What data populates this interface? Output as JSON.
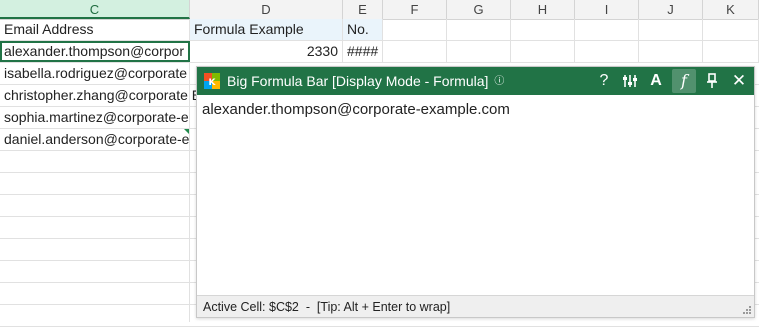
{
  "sheet": {
    "columns": [
      "C",
      "D",
      "E",
      "F",
      "G",
      "H",
      "I",
      "J",
      "K"
    ],
    "rows": [
      {
        "c": "Email Address",
        "d": "Formula Example",
        "e": "No."
      },
      {
        "c": "alexander.thompson@corpor",
        "d": "2330",
        "e": "####"
      },
      {
        "c": "isabella.rodriguez@corporate",
        "d": "",
        "e": ""
      },
      {
        "c": "christopher.zhang@corporate E",
        "d": "",
        "e": ""
      },
      {
        "c": "sophia.martinez@corporate-e",
        "d": "",
        "e": ""
      },
      {
        "c": "daniel.anderson@corporate-e",
        "d": "",
        "e": ""
      }
    ]
  },
  "formula_bar": {
    "title": "Big Formula Bar [Display Mode - Formula]",
    "info_glyph": "ⓘ",
    "content": "alexander.thompson@corporate-example.com",
    "status": "Active Cell: $C$2  -  [Tip: Alt + Enter to wrap]",
    "buttons": {
      "help": "?",
      "settings": "⚙",
      "font": "A",
      "formula": "f",
      "pin": "⚲",
      "close": "✕"
    }
  },
  "colors": {
    "accent": "#217346",
    "header_highlight": "#d3f0e0",
    "header_fill": "#eaf4fb"
  }
}
